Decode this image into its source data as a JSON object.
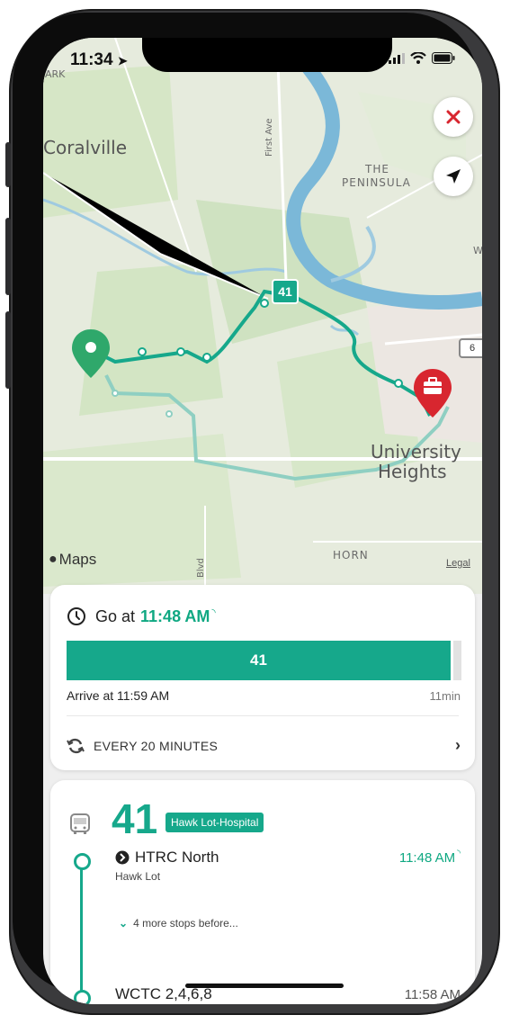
{
  "status_bar": {
    "time": "11:34"
  },
  "map": {
    "labels": {
      "coralville": "Coralville",
      "first_ave": "First Ave",
      "the": "THE",
      "peninsula": "PENINSULA",
      "university": "University",
      "heights": "Heights",
      "horn": "HORN",
      "blvd": "Blvd",
      "park": "ARK",
      "w": "W",
      "route_badge": "41",
      "highway": "6",
      "maps": "Maps",
      "legal": "Legal"
    },
    "route_color": "#16a88b",
    "destination_color": "#d8262f"
  },
  "trip_card": {
    "go_at_prefix": "Go at",
    "go_at_time": "11:48 AM",
    "route_label": "41",
    "arrive_text": "Arrive at 11:59 AM",
    "duration": "11min",
    "frequency": "EVERY 20 MINUTES"
  },
  "detail_card": {
    "route_number": "41",
    "route_name": "Hawk Lot-Hospital",
    "stops": [
      {
        "name": "HTRC North",
        "subtitle": "Hawk Lot",
        "time": "11:48 AM"
      },
      {
        "name": "WCTC 2,4,6,8",
        "time": "11:58 AM"
      }
    ],
    "more_stops": "4 more stops before..."
  },
  "colors": {
    "accent": "#0fa882",
    "text": "#222222"
  }
}
